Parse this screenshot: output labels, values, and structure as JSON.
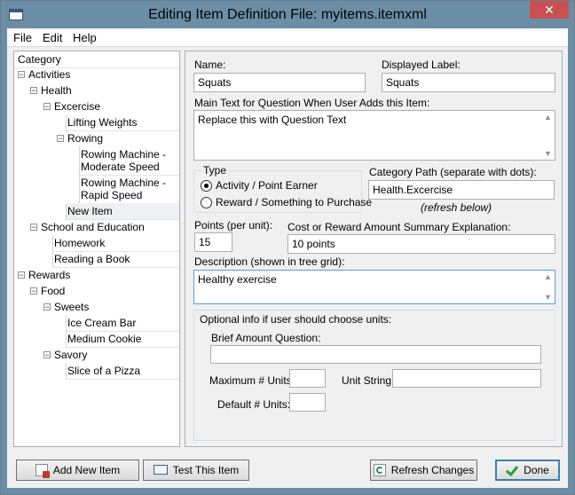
{
  "window": {
    "title": "Editing Item Definition File: myitems.itemxml",
    "close_glyph": "✕"
  },
  "menu": {
    "file": "File",
    "edit": "Edit",
    "help": "Help"
  },
  "tree": {
    "header": "Category",
    "activities": "Activities",
    "health": "Health",
    "excercise": "Excercise",
    "lifting_weights": "Lifting Weights",
    "rowing": "Rowing",
    "rowing_moderate_1": "Rowing Machine -",
    "rowing_moderate_2": "Moderate Speed",
    "rowing_rapid_1": "Rowing Machine -",
    "rowing_rapid_2": "Rapid Speed",
    "new_item": "New Item",
    "school": "School and Education",
    "homework": "Homework",
    "reading": "Reading a Book",
    "rewards": "Rewards",
    "food": "Food",
    "sweets": "Sweets",
    "ice_cream": "Ice Cream Bar",
    "medium_cookie": "Medium Cookie",
    "savory": "Savory",
    "pizza": "Slice of a Pizza",
    "expander_minus": "−"
  },
  "form": {
    "name_label": "Name:",
    "name_value": "Squats",
    "display_label": "Displayed Label:",
    "display_value": "Squats",
    "main_text_label": "Main Text for Question When User Adds this Item:",
    "main_text_value": "Replace this with Question Text",
    "type_label": "Type",
    "type_option_1": "Activity / Point Earner",
    "type_option_2": "Reward / Something to Purchase",
    "type_selected": "Activity / Point Earner",
    "category_path_label": "Category Path (separate with dots):",
    "category_path_value": "Health.Excercise",
    "refresh_note": "(refresh below)",
    "points_label": "Points (per unit):",
    "points_value": "15",
    "cost_label": "Cost or Reward Amount Summary Explanation:",
    "cost_value": "10 points",
    "description_label": "Description (shown in tree grid):",
    "description_value": "Healthy exercise",
    "optional_label": "Optional info if user should choose units:",
    "brief_label": "Brief Amount Question:",
    "brief_value": "",
    "max_units_label": "Maximum # Units:",
    "max_units_value": "",
    "unit_string_label": "Unit String:",
    "unit_string_value": "",
    "default_units_label": "Default # Units:",
    "default_units_value": "",
    "scroll_up": "▲",
    "scroll_down": "▼"
  },
  "buttons": {
    "add_new": "Add New Item",
    "test": "Test This Item",
    "refresh": "Refresh Changes",
    "done": "Done"
  },
  "colors": {
    "titlebar": "#6b8ea6",
    "close": "#c75050",
    "focus_border": "#569de5",
    "done_border": "#3c7fb1",
    "check_green": "#2e9d2e"
  }
}
